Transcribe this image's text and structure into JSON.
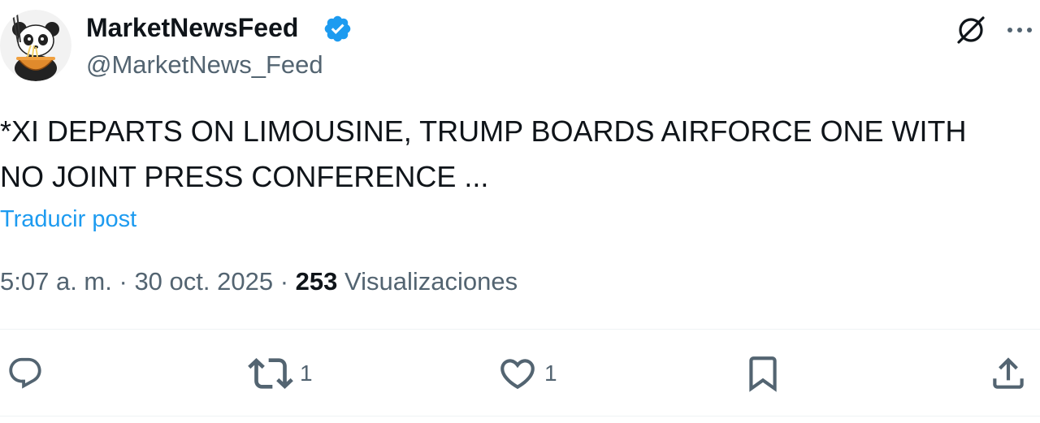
{
  "author": {
    "name": "MarketNewsFeed",
    "handle": "@MarketNews_Feed",
    "avatar_icon": "panda-eating-noodles-avatar",
    "verified_icon": "verified-badge-icon",
    "verified_color": "#1d9bf0"
  },
  "header_actions": {
    "grok_icon": "grok-icon",
    "more_icon": "more-options-icon"
  },
  "post": {
    "text": "*XI DEPARTS ON LIMOUSINE, TRUMP BOARDS AIRFORCE ONE WITH\nNO JOINT PRESS CONFERENCE ...",
    "translate_label": "Traducir post"
  },
  "meta": {
    "time": "5:07 a. m.",
    "separator": "·",
    "date": "30 oct. 2025",
    "views_count": "253",
    "views_label": "Visualizaciones"
  },
  "actions": {
    "reply": {
      "icon": "reply-icon",
      "count": ""
    },
    "retweet": {
      "icon": "retweet-icon",
      "count": "1"
    },
    "like": {
      "icon": "heart-icon",
      "count": "1"
    },
    "bookmark": {
      "icon": "bookmark-icon",
      "count": ""
    },
    "share": {
      "icon": "share-icon",
      "count": ""
    }
  },
  "colors": {
    "text_primary": "#0f1419",
    "text_secondary": "#536471",
    "link": "#1d9bf0",
    "divider": "#eff3f4"
  }
}
